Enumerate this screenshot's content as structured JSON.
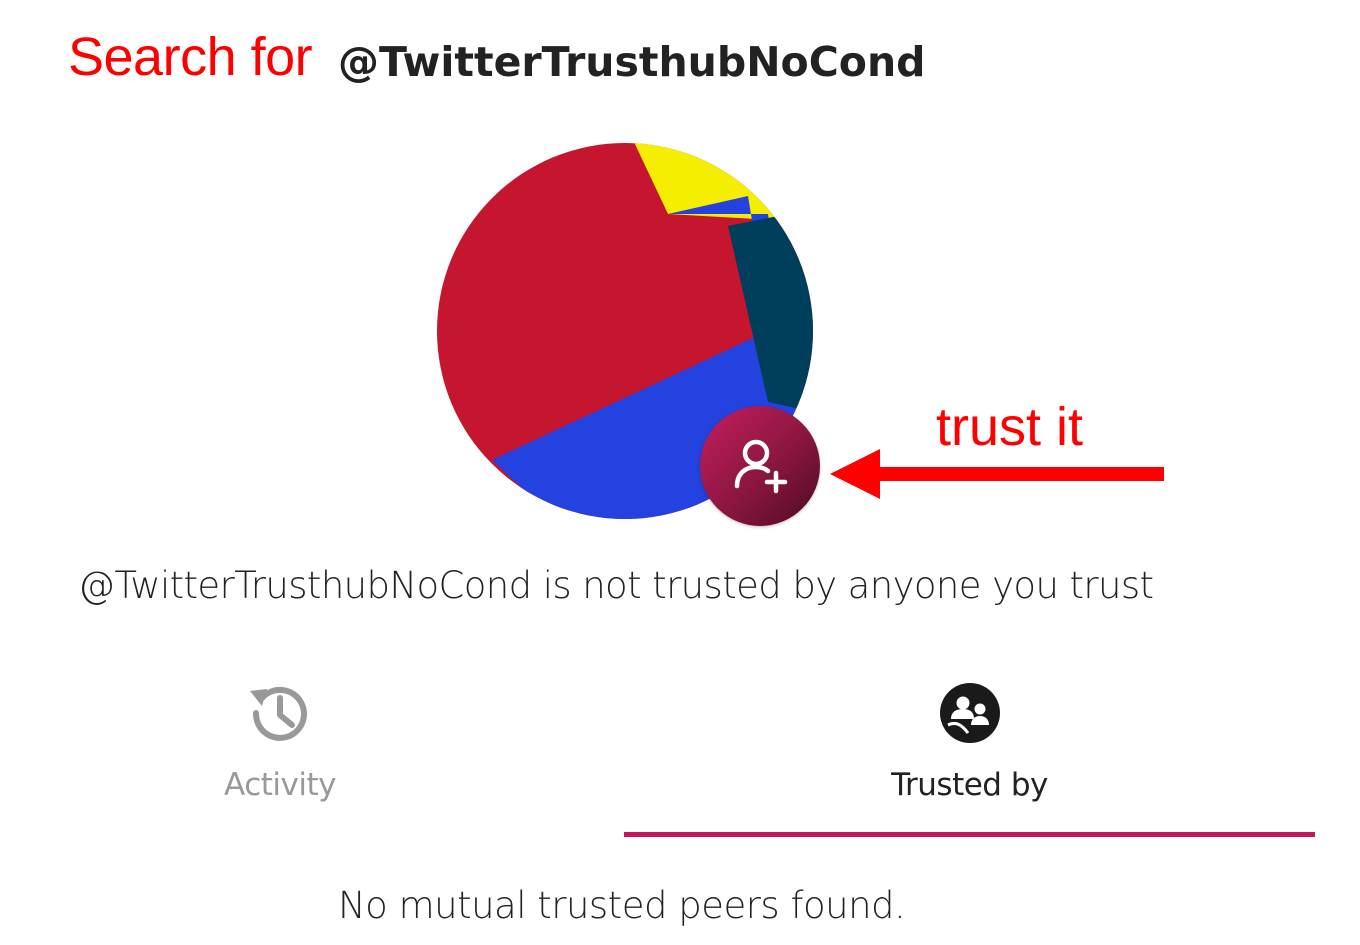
{
  "annotations": {
    "search_label": "Search for",
    "trust_label": "trust it",
    "color": "#ff0000"
  },
  "profile": {
    "handle": "@TwitterTrusthubNoCond",
    "status_text": "@TwitterTrusthubNoCond is not trusted by anyone you trust",
    "avatar_colors": [
      "#c5152f",
      "#2342e0",
      "#f5ee00",
      "#003f5c"
    ],
    "trust_button_icon": "person-add-icon",
    "trust_button_color": "#8b1640"
  },
  "tabs": [
    {
      "label": "Activity",
      "icon": "history-icon",
      "active": false
    },
    {
      "label": "Trusted by",
      "icon": "group-icon",
      "active": true
    }
  ],
  "tab_indicator_color": "#c2185b",
  "trusted_by": {
    "empty_message": "No mutual trusted peers found."
  }
}
